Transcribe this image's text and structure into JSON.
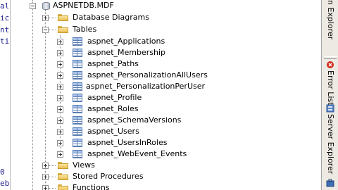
{
  "code_strip": {
    "lines": [
      "al",
      "ic",
      "nt",
      "ti",
      "0",
      "eb"
    ]
  },
  "tree": {
    "database": "ASPNETDB.MDF",
    "children": {
      "database_diagrams": "Database Diagrams",
      "tables": "Tables",
      "views": "Views",
      "stored_procedures": "Stored Procedures",
      "functions": "Functions"
    },
    "tables": [
      "aspnet_Applications",
      "aspnet_Membership",
      "aspnet_Paths",
      "aspnet_PersonalizationAllUsers",
      "aspnet_PersonalizationPerUser",
      "aspnet_Profile",
      "aspnet_Roles",
      "aspnet_SchemaVersions",
      "aspnet_Users",
      "aspnet_UsersInRoles",
      "aspnet_WebEvent_Events"
    ]
  },
  "side_tabs": {
    "solution_explorer": "n Explorer",
    "error_list": "Error List",
    "server_explorer": "Server Explorer"
  },
  "colors": {
    "folder": "#f2cf6e",
    "table_border": "#5b7db3",
    "panel_bg": "#eceae2"
  }
}
